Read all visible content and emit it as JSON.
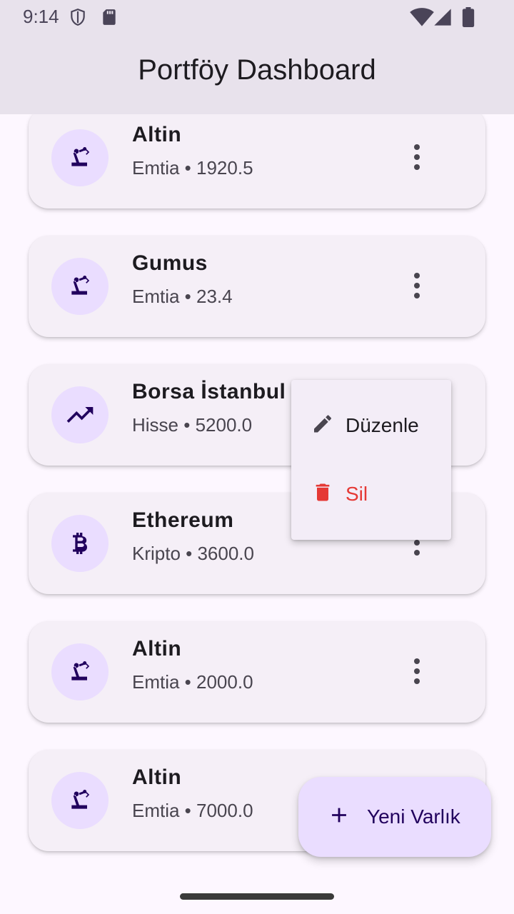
{
  "status_bar": {
    "time": "9:14"
  },
  "app_bar": {
    "title": "Portföy Dashboard"
  },
  "assets": [
    {
      "name": "Altin",
      "subtitle": "Emtia • 1920.5",
      "icon": "precision-manufacturing-icon"
    },
    {
      "name": "Gumus",
      "subtitle": "Emtia • 23.4",
      "icon": "precision-manufacturing-icon"
    },
    {
      "name": "Borsa İstanbul",
      "subtitle": "Hisse • 5200.0",
      "icon": "trending-up-icon"
    },
    {
      "name": "Ethereum",
      "subtitle": "Kripto • 3600.0",
      "icon": "bitcoin-icon"
    },
    {
      "name": "Altin",
      "subtitle": "Emtia • 2000.0",
      "icon": "precision-manufacturing-icon"
    },
    {
      "name": "Altin",
      "subtitle": "Emtia • 7000.0",
      "icon": "precision-manufacturing-icon"
    }
  ],
  "popup_menu": {
    "edit_label": "Düzenle",
    "delete_label": "Sil",
    "delete_color": "#e53935"
  },
  "fab": {
    "label": "Yeni Varlık"
  },
  "colors": {
    "primary_container": "#eaddff",
    "surface": "#fdf7ff",
    "app_bar": "#e8e2ec"
  }
}
